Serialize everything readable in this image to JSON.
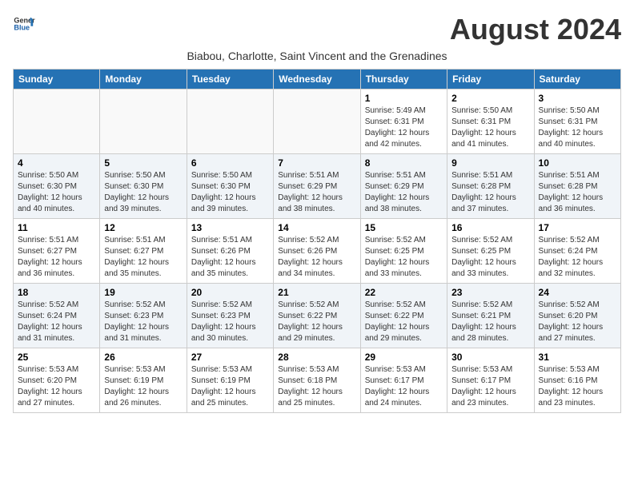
{
  "logo": {
    "line1": "General",
    "line2": "Blue"
  },
  "title": "August 2024",
  "subtitle": "Biabou, Charlotte, Saint Vincent and the Grenadines",
  "weekdays": [
    "Sunday",
    "Monday",
    "Tuesday",
    "Wednesday",
    "Thursday",
    "Friday",
    "Saturday"
  ],
  "weeks": [
    [
      {
        "day": "",
        "info": ""
      },
      {
        "day": "",
        "info": ""
      },
      {
        "day": "",
        "info": ""
      },
      {
        "day": "",
        "info": ""
      },
      {
        "day": "1",
        "info": "Sunrise: 5:49 AM\nSunset: 6:31 PM\nDaylight: 12 hours\nand 42 minutes."
      },
      {
        "day": "2",
        "info": "Sunrise: 5:50 AM\nSunset: 6:31 PM\nDaylight: 12 hours\nand 41 minutes."
      },
      {
        "day": "3",
        "info": "Sunrise: 5:50 AM\nSunset: 6:31 PM\nDaylight: 12 hours\nand 40 minutes."
      }
    ],
    [
      {
        "day": "4",
        "info": "Sunrise: 5:50 AM\nSunset: 6:30 PM\nDaylight: 12 hours\nand 40 minutes."
      },
      {
        "day": "5",
        "info": "Sunrise: 5:50 AM\nSunset: 6:30 PM\nDaylight: 12 hours\nand 39 minutes."
      },
      {
        "day": "6",
        "info": "Sunrise: 5:50 AM\nSunset: 6:30 PM\nDaylight: 12 hours\nand 39 minutes."
      },
      {
        "day": "7",
        "info": "Sunrise: 5:51 AM\nSunset: 6:29 PM\nDaylight: 12 hours\nand 38 minutes."
      },
      {
        "day": "8",
        "info": "Sunrise: 5:51 AM\nSunset: 6:29 PM\nDaylight: 12 hours\nand 38 minutes."
      },
      {
        "day": "9",
        "info": "Sunrise: 5:51 AM\nSunset: 6:28 PM\nDaylight: 12 hours\nand 37 minutes."
      },
      {
        "day": "10",
        "info": "Sunrise: 5:51 AM\nSunset: 6:28 PM\nDaylight: 12 hours\nand 36 minutes."
      }
    ],
    [
      {
        "day": "11",
        "info": "Sunrise: 5:51 AM\nSunset: 6:27 PM\nDaylight: 12 hours\nand 36 minutes."
      },
      {
        "day": "12",
        "info": "Sunrise: 5:51 AM\nSunset: 6:27 PM\nDaylight: 12 hours\nand 35 minutes."
      },
      {
        "day": "13",
        "info": "Sunrise: 5:51 AM\nSunset: 6:26 PM\nDaylight: 12 hours\nand 35 minutes."
      },
      {
        "day": "14",
        "info": "Sunrise: 5:52 AM\nSunset: 6:26 PM\nDaylight: 12 hours\nand 34 minutes."
      },
      {
        "day": "15",
        "info": "Sunrise: 5:52 AM\nSunset: 6:25 PM\nDaylight: 12 hours\nand 33 minutes."
      },
      {
        "day": "16",
        "info": "Sunrise: 5:52 AM\nSunset: 6:25 PM\nDaylight: 12 hours\nand 33 minutes."
      },
      {
        "day": "17",
        "info": "Sunrise: 5:52 AM\nSunset: 6:24 PM\nDaylight: 12 hours\nand 32 minutes."
      }
    ],
    [
      {
        "day": "18",
        "info": "Sunrise: 5:52 AM\nSunset: 6:24 PM\nDaylight: 12 hours\nand 31 minutes."
      },
      {
        "day": "19",
        "info": "Sunrise: 5:52 AM\nSunset: 6:23 PM\nDaylight: 12 hours\nand 31 minutes."
      },
      {
        "day": "20",
        "info": "Sunrise: 5:52 AM\nSunset: 6:23 PM\nDaylight: 12 hours\nand 30 minutes."
      },
      {
        "day": "21",
        "info": "Sunrise: 5:52 AM\nSunset: 6:22 PM\nDaylight: 12 hours\nand 29 minutes."
      },
      {
        "day": "22",
        "info": "Sunrise: 5:52 AM\nSunset: 6:22 PM\nDaylight: 12 hours\nand 29 minutes."
      },
      {
        "day": "23",
        "info": "Sunrise: 5:52 AM\nSunset: 6:21 PM\nDaylight: 12 hours\nand 28 minutes."
      },
      {
        "day": "24",
        "info": "Sunrise: 5:52 AM\nSunset: 6:20 PM\nDaylight: 12 hours\nand 27 minutes."
      }
    ],
    [
      {
        "day": "25",
        "info": "Sunrise: 5:53 AM\nSunset: 6:20 PM\nDaylight: 12 hours\nand 27 minutes."
      },
      {
        "day": "26",
        "info": "Sunrise: 5:53 AM\nSunset: 6:19 PM\nDaylight: 12 hours\nand 26 minutes."
      },
      {
        "day": "27",
        "info": "Sunrise: 5:53 AM\nSunset: 6:19 PM\nDaylight: 12 hours\nand 25 minutes."
      },
      {
        "day": "28",
        "info": "Sunrise: 5:53 AM\nSunset: 6:18 PM\nDaylight: 12 hours\nand 25 minutes."
      },
      {
        "day": "29",
        "info": "Sunrise: 5:53 AM\nSunset: 6:17 PM\nDaylight: 12 hours\nand 24 minutes."
      },
      {
        "day": "30",
        "info": "Sunrise: 5:53 AM\nSunset: 6:17 PM\nDaylight: 12 hours\nand 23 minutes."
      },
      {
        "day": "31",
        "info": "Sunrise: 5:53 AM\nSunset: 6:16 PM\nDaylight: 12 hours\nand 23 minutes."
      }
    ]
  ]
}
